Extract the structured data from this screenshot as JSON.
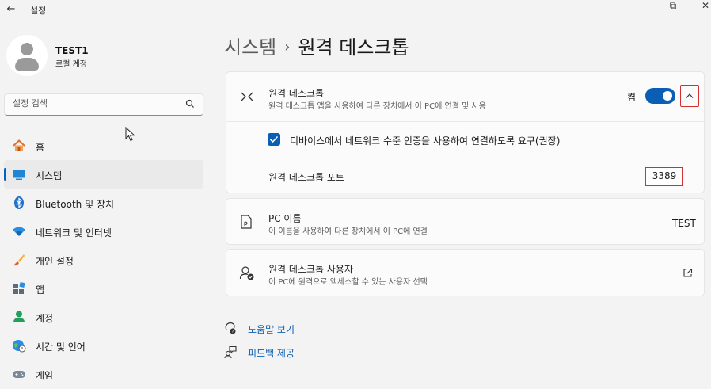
{
  "window": {
    "title": "설정",
    "back_glyph": "←",
    "minimize_glyph": "—",
    "maximize_glyph": "⧉",
    "close_glyph": "✕"
  },
  "user": {
    "name": "TEST1",
    "account_type": "로컬 계정"
  },
  "search": {
    "placeholder": "설정 검색"
  },
  "sidebar": {
    "items": [
      {
        "label": "홈",
        "icon": "home-icon"
      },
      {
        "label": "시스템",
        "icon": "system-icon",
        "selected": true
      },
      {
        "label": "Bluetooth 및 장치",
        "icon": "bluetooth-icon"
      },
      {
        "label": "네트워크 및 인터넷",
        "icon": "network-icon"
      },
      {
        "label": "개인 설정",
        "icon": "brush-icon"
      },
      {
        "label": "앱",
        "icon": "apps-icon"
      },
      {
        "label": "계정",
        "icon": "account-icon"
      },
      {
        "label": "시간 및 언어",
        "icon": "globe-clock-icon"
      },
      {
        "label": "게임",
        "icon": "gamepad-icon"
      }
    ]
  },
  "breadcrumb": {
    "parent": "시스템",
    "separator": "›",
    "current": "원격 데스크톱"
  },
  "remote_desktop": {
    "title": "원격 데스크톱",
    "description": "원격 데스크톱 앱을 사용하여 다른 장치에서 이 PC에 연결 및 사용",
    "toggle_state": "켬",
    "toggle_on": true,
    "nla_label": "디바이스에서 네트워크 수준 인증을 사용하여 연결하도록 요구(권장)",
    "nla_checked": true,
    "port_label": "원격 데스크톱 포트",
    "port_value": "3389"
  },
  "pc_name": {
    "title": "PC 이름",
    "description": "이 이름을 사용하여 다른 장치에서 이 PC에 연결",
    "value": "TEST"
  },
  "users": {
    "title": "원격 데스크톱 사용자",
    "description": "이 PC에 원격으로 액세스할 수 있는 사용자 선택"
  },
  "links": {
    "help": "도움말 보기",
    "feedback": "피드백 제공"
  },
  "colors": {
    "accent": "#0a5fb4",
    "highlight_border": "#d32f2f",
    "background": "#f3f3f3",
    "card": "#fbfbfb"
  }
}
